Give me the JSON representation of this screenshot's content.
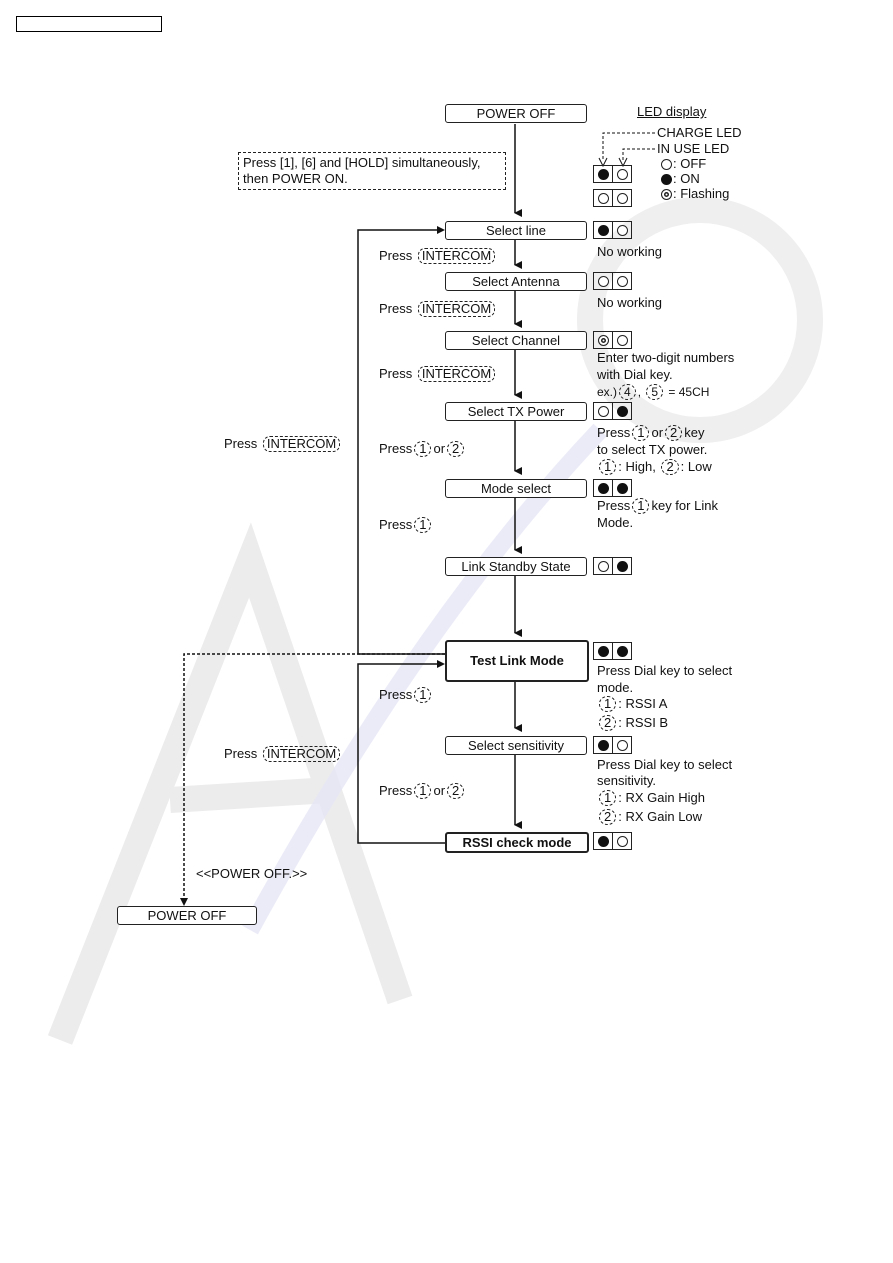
{
  "header_box": "",
  "led_legend": {
    "title": "LED display",
    "charge_led": "CHARGE LED",
    "in_use_led": "IN USE LED",
    "off": ": OFF",
    "on": ": ON",
    "flashing": ": Flashing"
  },
  "start_note": {
    "line1": "Press [1], [6] and [HOLD] simultaneously,",
    "line2": "then POWER ON."
  },
  "nodes": {
    "power_off_top": "POWER OFF",
    "select_line": "Select line",
    "select_antenna": "Select Antenna",
    "select_channel": "Select Channel",
    "select_tx_power": "Select TX Power",
    "mode_select": "Mode select",
    "link_standby": "Link Standby State",
    "test_link_mode": "Test Link Mode",
    "select_sensitivity": "Select sensitivity",
    "rssi_check_mode": "RSSI check mode",
    "power_off_bottom": "POWER OFF"
  },
  "leds": {
    "legend_a": [
      "on",
      "off"
    ],
    "legend_b": [
      "off",
      "off"
    ],
    "select_line": [
      "on",
      "off"
    ],
    "select_antenna": [
      "off",
      "off"
    ],
    "select_channel": [
      "flash",
      "off"
    ],
    "select_tx_power": [
      "off",
      "on"
    ],
    "mode_select": [
      "on",
      "on"
    ],
    "link_standby": [
      "off",
      "on"
    ],
    "test_link_mode": [
      "on",
      "on"
    ],
    "select_sensitivity": [
      "on",
      "off"
    ],
    "rssi_check_mode": [
      "on",
      "off"
    ]
  },
  "labels": {
    "press": "Press",
    "or": "or",
    "intercom": "INTERCOM",
    "key1": "1",
    "key2": "2",
    "key4": "4",
    "key5": "5",
    "power_off_transition": "<<POWER OFF.>>"
  },
  "notes": {
    "select_line": "No working",
    "select_antenna": "No working",
    "select_channel_1": "Enter two-digit numbers",
    "select_channel_2": "with Dial key.",
    "select_channel_ex": "ex.)",
    "select_channel_eq": "= 45CH",
    "tx_1a": "Press",
    "tx_1b": "or",
    "tx_1c": "key",
    "tx_2": "to select TX power.",
    "tx_3a": ": High,",
    "tx_3b": ": Low",
    "mode_1a": "Press",
    "mode_1b": "key for Link",
    "mode_2": "Mode.",
    "test_1": "Press Dial key to select",
    "test_2": "mode.",
    "test_3": ": RSSI A",
    "test_4": ": RSSI B",
    "sens_1": "Press Dial key to select",
    "sens_2": "sensitivity.",
    "sens_3": ": RX Gain High",
    "sens_4": ": RX Gain Low"
  }
}
